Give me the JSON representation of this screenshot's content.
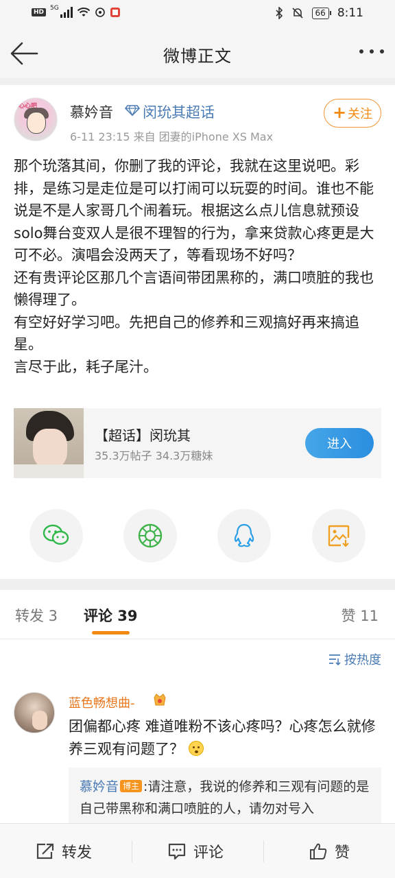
{
  "status_bar": {
    "hd": "HD",
    "network": "5G",
    "battery": "66",
    "time": "8:11"
  },
  "header": {
    "title": "微博正文"
  },
  "post": {
    "author": "慕妗音",
    "avatar_text": "心心吧",
    "topic": "闵玧其超话",
    "meta": "6-11 23:15   来自 团妻的iPhone XS Max",
    "follow_label": "关注",
    "paragraphs": [
      "那个玧落其间，你删了我的评论，我就在这里说吧。彩排，是练习是走位是可以打闹可以玩耍的时间。谁也不能说是不是人家哥几个闹着玩。根据这么点儿信息就预设solo舞台变双人是很不理智的行为，拿来贷款心疼更是大可不必。演唱会没两天了，等看现场不好吗？",
      "还有贵评论区那几个言语间带团黑称的，满口喷脏的我也懒得理了。",
      "有空好好学习吧。先把自己的修养和三观搞好再来搞追星。",
      "言尽于此，耗子尾汁。"
    ],
    "card": {
      "title": "【超话】闵玧其",
      "stats": "35.3万帖子 34.3万糖妹",
      "button": "进入"
    },
    "share_icons": [
      "wechat-icon",
      "moments-icon",
      "qq-icon",
      "save-image-icon"
    ],
    "share_colors": [
      "#2fb84a",
      "#3fb34a",
      "#2a9ee6",
      "#f0a020"
    ]
  },
  "tabs": {
    "repost": "转发 3",
    "comments": "评论 39",
    "likes": "赞 11"
  },
  "sort": {
    "label": "按热度"
  },
  "comment": {
    "name": "蓝色畅想曲-",
    "text": "团偏都心疼 难道唯粉不该心疼吗？心疼怎么就修养三观有问题了？",
    "reply": {
      "name": "慕妗音",
      "badge": "博主",
      "text": ":请注意，我说的修养和三观有问题的是自己带黑称和满口喷脏的人，请勿对号入"
    }
  },
  "bottom_bar": {
    "repost": "转发",
    "comment": "评论",
    "like": "赞"
  }
}
